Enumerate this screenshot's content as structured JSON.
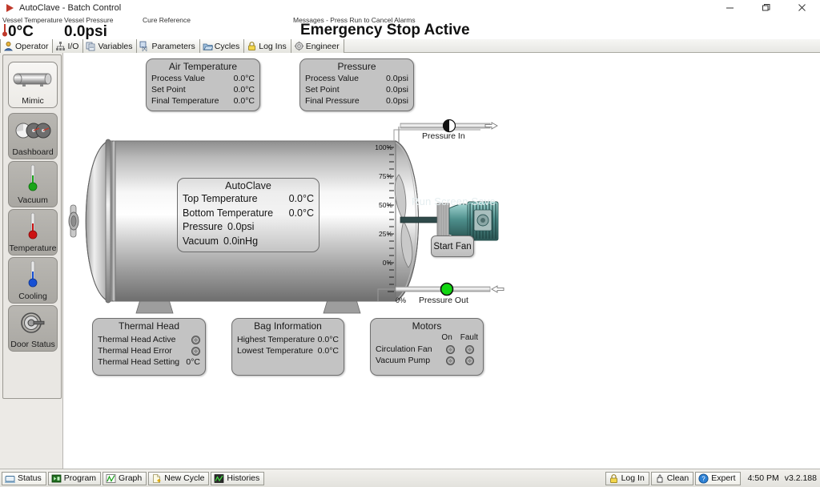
{
  "window": {
    "title": "AutoClave - Batch Control",
    "app_icon": "play-triangle-icon",
    "minimize": "−",
    "maximize": "❐",
    "close": "✕",
    "alarm_icon": "warning-triangle-icon"
  },
  "header": {
    "vessel_temperature_label": "Vessel Temperature",
    "vessel_temperature_value": "0°C",
    "vessel_pressure_label": "Vessel Pressure",
    "vessel_pressure_value": "0.0psi",
    "cure_reference_label": "Cure Reference",
    "cure_reference_value": "",
    "messages_label": "Messages - Press Run to Cancel Alarms",
    "messages_value": "Emergency Stop Active"
  },
  "tabs": [
    {
      "label": "Operator",
      "icon": "operator-icon",
      "active": true
    },
    {
      "label": "I/O",
      "icon": "io-icon",
      "active": false
    },
    {
      "label": "Variables",
      "icon": "variables-icon",
      "active": false
    },
    {
      "label": "Parameters",
      "icon": "parameters-icon",
      "active": false
    },
    {
      "label": "Cycles",
      "icon": "cycles-icon",
      "active": false
    },
    {
      "label": "Log Ins",
      "icon": "lock-icon",
      "active": false
    },
    {
      "label": "Engineer",
      "icon": "gear-icon",
      "active": false
    }
  ],
  "sidebar": {
    "items": [
      {
        "label": "Mimic",
        "icon": "vessel-icon",
        "selected": true
      },
      {
        "label": "Dashboard",
        "icon": "gauges-icon",
        "selected": false
      },
      {
        "label": "Vacuum",
        "icon": "thermometer-green-icon",
        "selected": false
      },
      {
        "label": "Temperature",
        "icon": "thermometer-red-icon",
        "selected": false
      },
      {
        "label": "Cooling",
        "icon": "thermometer-blue-icon",
        "selected": false
      },
      {
        "label": "Door Status",
        "icon": "door-icon",
        "selected": false
      }
    ]
  },
  "panels": {
    "air_temperature": {
      "title": "Air Temperature",
      "rows": [
        {
          "label": "Process Value",
          "value": "0.0°C"
        },
        {
          "label": "Set Point",
          "value": "0.0°C"
        },
        {
          "label": "Final Temperature",
          "value": "0.0°C"
        }
      ]
    },
    "pressure": {
      "title": "Pressure",
      "rows": [
        {
          "label": "Process Value",
          "value": "0.0psi"
        },
        {
          "label": "Set Point",
          "value": "0.0psi"
        },
        {
          "label": "Final Pressure",
          "value": "0.0psi"
        }
      ]
    },
    "autoclave": {
      "title": "AutoClave",
      "rows": [
        {
          "label": "Top Temperature",
          "value": "0.0°C"
        },
        {
          "label": "Bottom Temperature",
          "value": "0.0°C"
        },
        {
          "label": "Pressure",
          "value": "0.0psi"
        },
        {
          "label": "Vacuum",
          "value": "0.0inHg"
        }
      ]
    },
    "thermal_head": {
      "title": "Thermal Head",
      "rows": [
        {
          "label": "Thermal Head Active",
          "value": "",
          "led": true
        },
        {
          "label": "Thermal Head Error",
          "value": "",
          "led": true
        },
        {
          "label": "Thermal Head Setting",
          "value": "0°C",
          "led": false
        }
      ]
    },
    "bag_information": {
      "title": "Bag Information",
      "rows": [
        {
          "label": "Highest Temperature",
          "value": "0.0°C"
        },
        {
          "label": "Lowest Temperature",
          "value": "0.0°C"
        }
      ]
    },
    "motors": {
      "title": "Motors",
      "col_on": "On",
      "col_fault": "Fault",
      "rows": [
        {
          "label": "Circulation Fan"
        },
        {
          "label": "Vacuum Pump"
        }
      ]
    }
  },
  "mimic": {
    "start_fan_button": "Start Fan",
    "watermark": "Run Screen Save",
    "pressure_in_label": "Pressure In",
    "pressure_out_label": "Pressure Out",
    "pressure_in_state_color": "#111111",
    "pressure_out_state_color": "#12d612",
    "scale_ticks": [
      "100%",
      "75%",
      "50%",
      "25%",
      "0%"
    ],
    "scale_zero_label": "0%"
  },
  "statusbar": {
    "left_buttons": [
      {
        "label": "Status",
        "icon": "status-icon",
        "active": true
      },
      {
        "label": "Program",
        "icon": "program-icon",
        "active": false
      },
      {
        "label": "Graph",
        "icon": "graph-icon",
        "active": false
      },
      {
        "label": "New Cycle",
        "icon": "newcycle-icon",
        "active": false
      },
      {
        "label": "Histories",
        "icon": "histories-icon",
        "active": false
      }
    ],
    "right_buttons": [
      {
        "label": "Log In",
        "icon": "lock-icon",
        "active": false
      },
      {
        "label": "Clean",
        "icon": "hand-icon",
        "active": false
      },
      {
        "label": "Expert",
        "icon": "help-icon",
        "active": true
      }
    ],
    "time": "4:50 PM",
    "version": "v3.2.188"
  }
}
